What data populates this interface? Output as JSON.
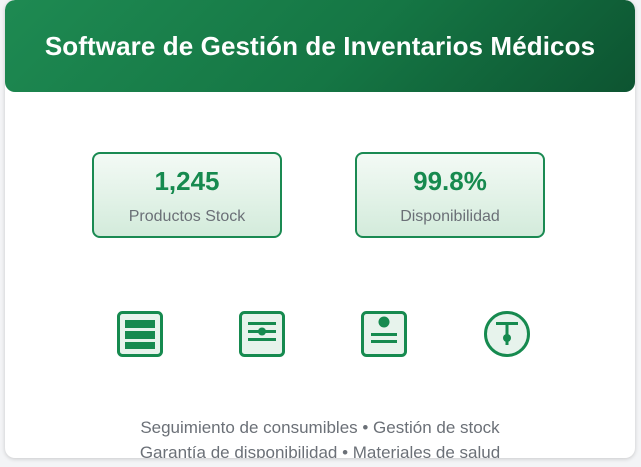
{
  "header": {
    "title": "Software de Gestión de Inventarios Médicos"
  },
  "stats": [
    {
      "value": "1,245",
      "label": "Productos Stock"
    },
    {
      "value": "99.8%",
      "label": "Disponibilidad"
    }
  ],
  "icons": [
    {
      "name": "storage-shelves-icon"
    },
    {
      "name": "sliders-settings-icon"
    },
    {
      "name": "id-badge-icon"
    },
    {
      "name": "tracking-pin-icon"
    }
  ],
  "footer": {
    "line1": "Seguimiento de consumibles • Gestión de stock",
    "line2": "Garantía de disponibilidad • Materiales de salud"
  },
  "colors": {
    "accent": "#168a4f",
    "header_dark": "#0d5431",
    "text_muted": "#6b7077"
  }
}
